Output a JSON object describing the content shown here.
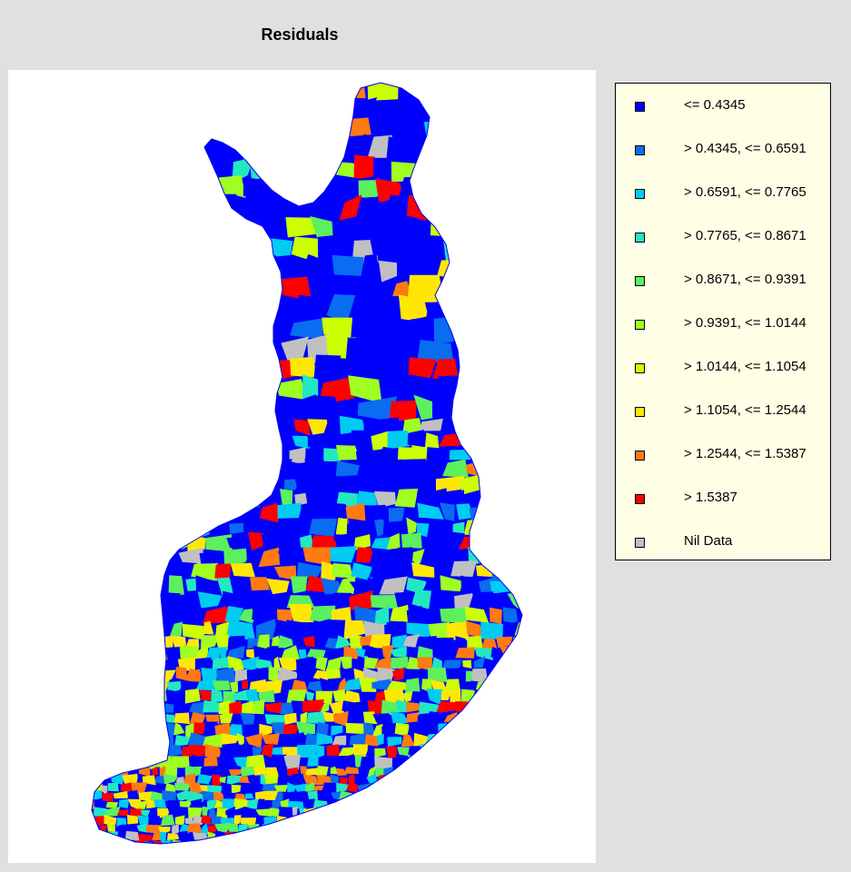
{
  "title": "Residuals",
  "legend": [
    {
      "label": "<= 0.4345",
      "color": "#0000ff"
    },
    {
      "label": "> 0.4345, <= 0.6591",
      "color": "#0a6cf0"
    },
    {
      "label": "> 0.6591, <= 0.7765",
      "color": "#00ccf2"
    },
    {
      "label": "> 0.7765, <= 0.8671",
      "color": "#22e8c0"
    },
    {
      "label": "> 0.8671, <= 0.9391",
      "color": "#5cf05c"
    },
    {
      "label": "> 0.9391, <= 1.0144",
      "color": "#a0ff20"
    },
    {
      "label": "> 1.0144, <= 1.1054",
      "color": "#ccff00"
    },
    {
      "label": "> 1.1054, <= 1.2544",
      "color": "#ffe800"
    },
    {
      "label": "> 1.2544, <= 1.5387",
      "color": "#ff7a10"
    },
    {
      "label": "> 1.5387",
      "color": "#ff0000"
    },
    {
      "label": "Nil Data",
      "color": "#c0c0c0"
    }
  ]
}
